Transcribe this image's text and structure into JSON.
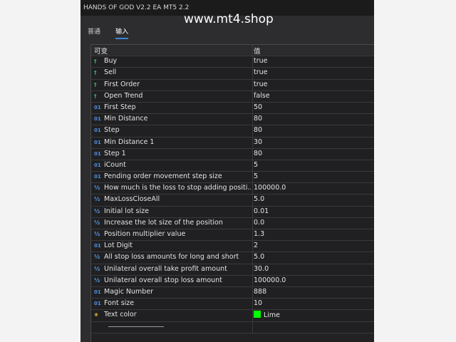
{
  "window": {
    "title": "HANDS OF GOD V2.2 EA MT5 2.2"
  },
  "watermark": "www.mt4.shop",
  "tabs": [
    {
      "label": "普通"
    },
    {
      "label": "输入"
    }
  ],
  "grid": {
    "headers": {
      "variable": "可变",
      "value": "值"
    },
    "rows": [
      {
        "type": "bool",
        "icon": "bool-icon",
        "name": "Buy",
        "value": "true"
      },
      {
        "type": "bool",
        "icon": "bool-icon",
        "name": "Sell",
        "value": "true"
      },
      {
        "type": "bool",
        "icon": "bool-icon",
        "name": "First Order",
        "value": "true"
      },
      {
        "type": "bool",
        "icon": "bool-icon",
        "name": "Open Trend",
        "value": "false"
      },
      {
        "type": "int",
        "icon": "int-icon",
        "name": "First Step",
        "value": "50"
      },
      {
        "type": "int",
        "icon": "int-icon",
        "name": "Min Distance",
        "value": "80"
      },
      {
        "type": "int",
        "icon": "int-icon",
        "name": "Step",
        "value": "80"
      },
      {
        "type": "int",
        "icon": "int-icon",
        "name": "Min Distance 1",
        "value": "30"
      },
      {
        "type": "int",
        "icon": "int-icon",
        "name": "Step 1",
        "value": "80"
      },
      {
        "type": "int",
        "icon": "int-icon",
        "name": "iCount",
        "value": "5"
      },
      {
        "type": "int",
        "icon": "int-icon",
        "name": "Pending order movement step size",
        "value": "5"
      },
      {
        "type": "double",
        "icon": "double-icon",
        "name": "How much is the loss to stop adding positi...",
        "value": "100000.0"
      },
      {
        "type": "double",
        "icon": "double-icon",
        "name": "MaxLossCloseAll",
        "value": "5.0"
      },
      {
        "type": "double",
        "icon": "double-icon",
        "name": "Initial lot size",
        "value": "0.01"
      },
      {
        "type": "double",
        "icon": "double-icon",
        "name": "Increase the lot size of the position",
        "value": "0.0"
      },
      {
        "type": "double",
        "icon": "double-icon",
        "name": "Position multiplier value",
        "value": "1.3"
      },
      {
        "type": "int",
        "icon": "int-icon",
        "name": "Lot Digit",
        "value": "2"
      },
      {
        "type": "double",
        "icon": "double-icon",
        "name": "All stop loss amounts for long and short",
        "value": "5.0"
      },
      {
        "type": "double",
        "icon": "double-icon",
        "name": "Unilateral overall take profit amount",
        "value": "30.0"
      },
      {
        "type": "double",
        "icon": "double-icon",
        "name": "Unilateral overall stop loss amount",
        "value": "100000.0"
      },
      {
        "type": "int",
        "icon": "int-icon",
        "name": "Magic Number",
        "value": "888"
      },
      {
        "type": "int",
        "icon": "int-icon",
        "name": "Font size",
        "value": "10"
      },
      {
        "type": "color",
        "icon": "color-icon",
        "name": "Text color",
        "value": "Lime",
        "swatch": "#00ff00"
      },
      {
        "type": "separator",
        "icon": "separator-icon",
        "name": "",
        "value": ""
      }
    ]
  },
  "colors": {
    "window_bg": "#2d2d30",
    "grid_bg": "#222224",
    "text": "#e4e4e4",
    "tab_underline": "#3a86d8",
    "bool_icon": "#3bbf6a",
    "int_icon": "#4f8fe0",
    "color_swatch": "#00ff00"
  }
}
